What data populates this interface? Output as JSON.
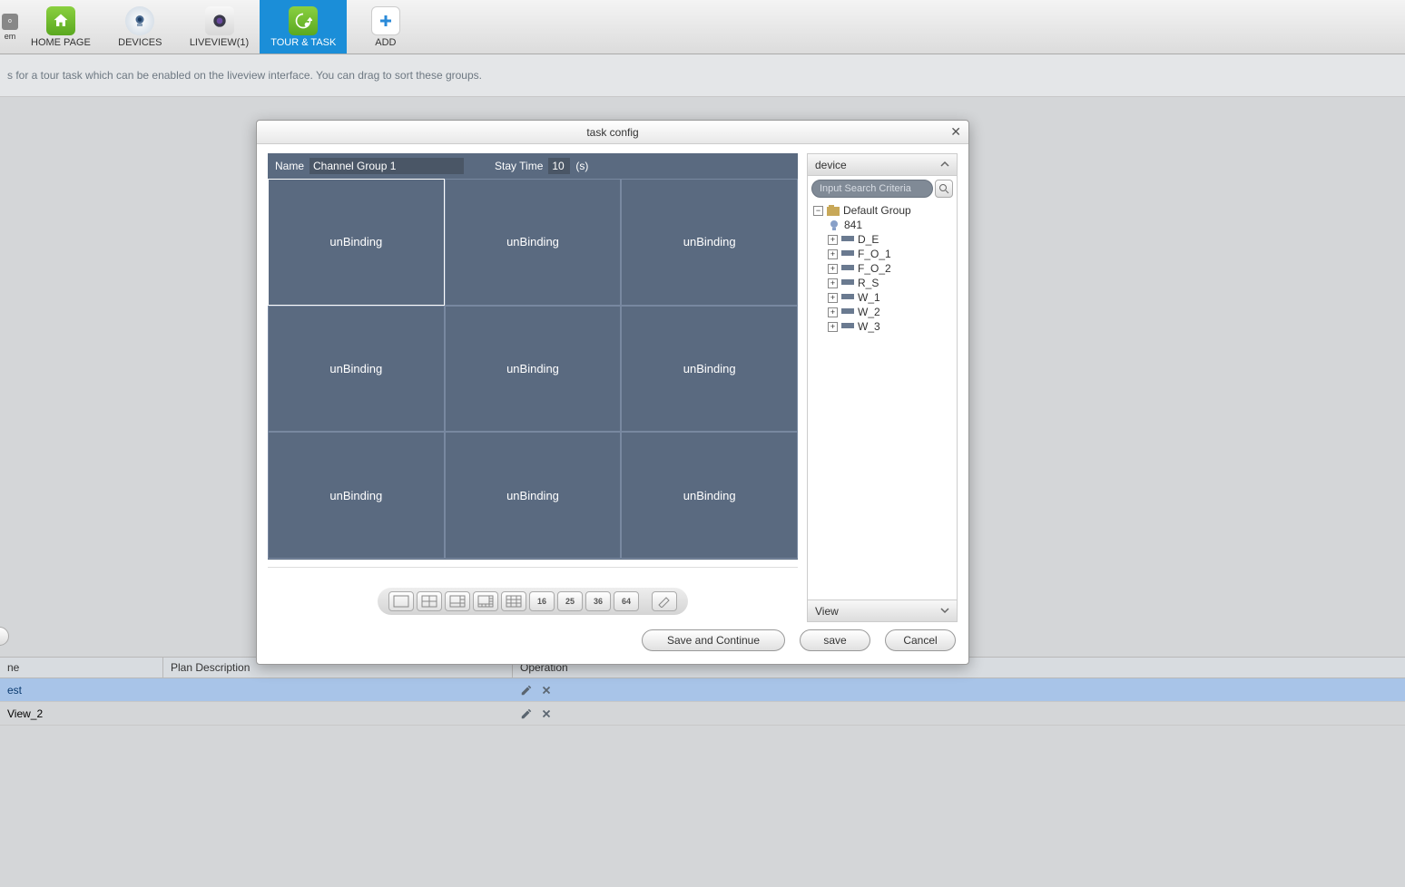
{
  "toolbar": {
    "tabs": [
      {
        "label": "HOME PAGE"
      },
      {
        "label": "DEVICES"
      },
      {
        "label": "LIVEVIEW(1)"
      },
      {
        "label": "TOUR & TASK"
      },
      {
        "label": "ADD"
      }
    ],
    "active_index": 3
  },
  "instruction": "s for a tour task which can be enabled on the liveview interface. You can drag to sort these groups.",
  "table": {
    "headers": [
      "ne",
      "Plan Description",
      "Operation"
    ],
    "rows": [
      {
        "name": "est",
        "desc": ""
      },
      {
        "name": "View_2",
        "desc": ""
      }
    ]
  },
  "dialog": {
    "title": "task config",
    "name_label": "Name",
    "name_value": "Channel Group 1",
    "stay_label": "Stay Time",
    "stay_value": "10",
    "stay_unit": "(s)",
    "cell_label": "unBinding",
    "layout_numbers": [
      "16",
      "25",
      "36",
      "64"
    ],
    "device_header": "device",
    "search_placeholder": "Input Search Criteria",
    "tree": {
      "root": "Default Group",
      "camera": "841",
      "nodes": [
        "D_E",
        "F_O_1",
        "F_O_2",
        "R_S",
        "W_1",
        "W_2",
        "W_3"
      ]
    },
    "view_footer": "View",
    "buttons": {
      "save_continue": "Save and Continue",
      "save": "save",
      "cancel": "Cancel"
    }
  }
}
